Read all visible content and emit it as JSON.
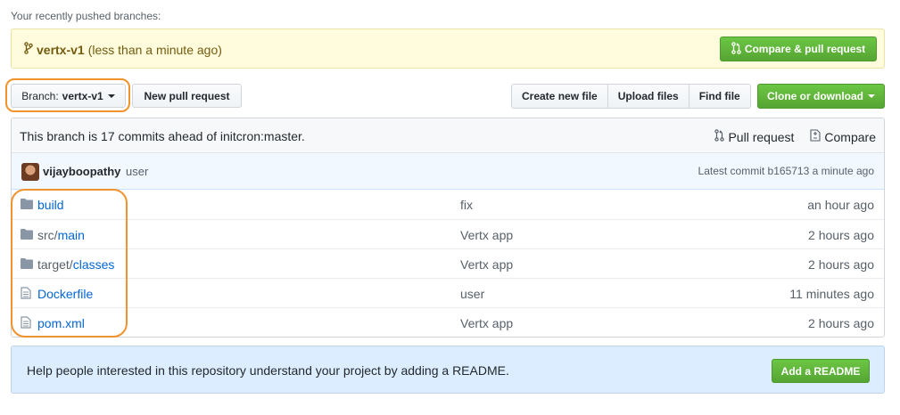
{
  "recent": {
    "label": "Your recently pushed branches:"
  },
  "flash": {
    "branch_name": "vertx-v1",
    "pushed_time": "(less than a minute ago)",
    "compare_label": "Compare & pull request"
  },
  "toolbar": {
    "branch_prefix": "Branch:",
    "branch_value": "vertx-v1",
    "new_pr_label": "New pull request",
    "create_file_label": "Create new file",
    "upload_label": "Upload files",
    "find_label": "Find file",
    "clone_label": "Clone or download"
  },
  "ahead": {
    "text": "This branch is 17 commits ahead of initcron:master.",
    "pull_request_label": "Pull request",
    "compare_label": "Compare"
  },
  "commit": {
    "author": "vijayboopathy",
    "message": "user",
    "latest": "Latest commit b165713 a minute ago"
  },
  "files": [
    {
      "type": "folder",
      "prefix": "",
      "name": "build",
      "message": "fix",
      "age": "an hour ago"
    },
    {
      "type": "folder",
      "prefix": "src/",
      "name": "main",
      "message": "Vertx app",
      "age": "2 hours ago"
    },
    {
      "type": "folder",
      "prefix": "target/",
      "name": "classes",
      "message": "Vertx app",
      "age": "2 hours ago"
    },
    {
      "type": "file",
      "prefix": "",
      "name": "Dockerfile",
      "message": "user",
      "age": "11 minutes ago"
    },
    {
      "type": "file",
      "prefix": "",
      "name": "pom.xml",
      "message": "Vertx app",
      "age": "2 hours ago"
    }
  ],
  "readme": {
    "text": "Help people interested in this repository understand your project by adding a README.",
    "button_label": "Add a README"
  },
  "colors": {
    "accent_green": "#28a745",
    "link_blue": "#0366d6",
    "highlight_orange": "#f1932d"
  }
}
